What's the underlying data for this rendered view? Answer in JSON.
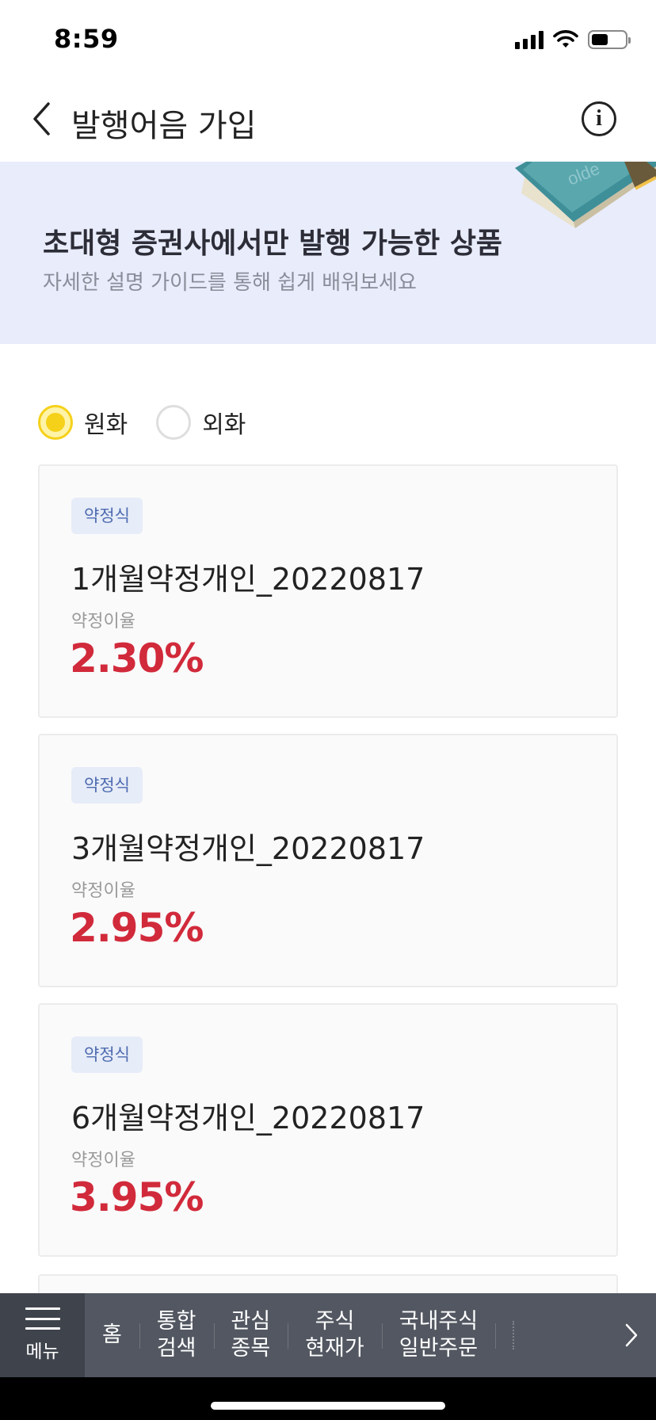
{
  "status_bar": {
    "time": "8:59"
  },
  "header": {
    "title": "발행어음 가입"
  },
  "banner": {
    "title": "초대형 증권사에서만 발행 가능한 상품",
    "subtitle": "자세한 설명 가이드를 통해 쉽게 배워보세요"
  },
  "currency": {
    "selected": "원화",
    "options": [
      "원화",
      "외화"
    ]
  },
  "products": [
    {
      "tag": "약정식",
      "name": "1개월약정개인_20220817",
      "rate_label": "약정이율",
      "rate": "2.30%"
    },
    {
      "tag": "약정식",
      "name": "3개월약정개인_20220817",
      "rate_label": "약정이율",
      "rate": "2.95%"
    },
    {
      "tag": "약정식",
      "name": "6개월약정개인_20220817",
      "rate_label": "약정이율",
      "rate": "3.95%"
    }
  ],
  "bottom_nav": {
    "menu_label": "메뉴",
    "items": [
      "홈",
      "통합\n검색",
      "관심\n종목",
      "주식\n현재가",
      "국내주식\n일반주문"
    ]
  },
  "colors": {
    "rate": "#d12a3b",
    "radio_selected": "#f5d11a",
    "banner_bg": "#e8ecfb",
    "tag_text": "#4e6bb0",
    "nav_bg": "#525761"
  },
  "icons": {
    "back": "chevron-left-icon",
    "info": "info-circle-icon",
    "menu": "hamburger-icon",
    "next": "chevron-right-icon"
  }
}
